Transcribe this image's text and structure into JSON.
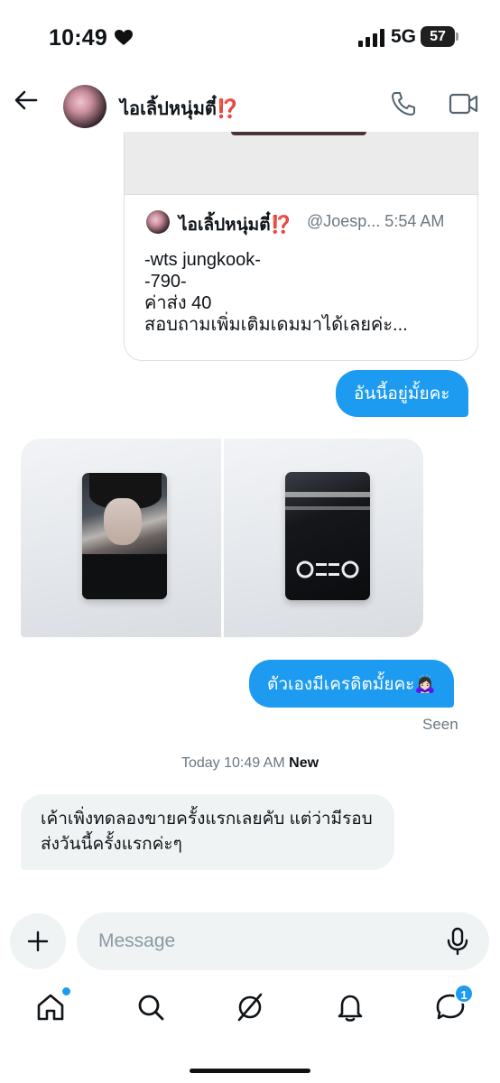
{
  "status_bar": {
    "time": "10:49",
    "network": "5G",
    "battery": "57",
    "icons": [
      "heart-icon",
      "signal-icon"
    ]
  },
  "header": {
    "name": "ไอเลิ้ปหนุ่มตี๋⁉️",
    "icons": [
      "back-arrow-icon",
      "phone-icon",
      "video-icon"
    ]
  },
  "quoted_post": {
    "author": "ไอเลิ้ปหนุ่มตี๋⁉️",
    "handle_time": "@Joesp... 5:54 AM",
    "lines": [
      "-wts jungkook-",
      "-790-",
      "ค่าส่ง 40",
      "สอบถามเพิ่มเติมเดมมาได้เลยค่ะ..."
    ]
  },
  "messages": [
    {
      "side": "sent",
      "text": "อันนี้อยู่มั้ยคะ"
    },
    {
      "side": "received",
      "type": "photos"
    },
    {
      "side": "sent",
      "text": "ตัวเองมีเครดิตมั้ยคะ🙇🏻‍♀️"
    },
    {
      "side": "received",
      "text": "เค้าเพิ่งทดลองขายครั้งแรกเลยคับ แต่ว่ามีรอบส่งวันนี้ครั้งแรกค่ะๆ"
    }
  ],
  "seen_label": "Seen",
  "timestamp": {
    "time": "Today 10:49 AM",
    "new_label": "New"
  },
  "composer": {
    "placeholder": "Message"
  },
  "bottom_nav": {
    "items": [
      "home-icon",
      "search-icon",
      "grok-icon",
      "notifications-icon",
      "messages-icon"
    ],
    "messages_badge": "1"
  },
  "colors": {
    "accent": "#1d9bf0",
    "bubble_received": "#eff3f4",
    "text": "#0f1419",
    "muted": "#6b7780"
  }
}
